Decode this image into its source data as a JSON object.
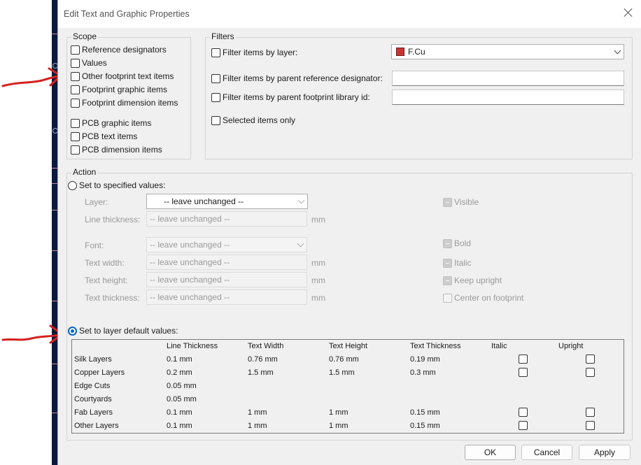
{
  "dialog": {
    "title": "Edit Text and Graphic Properties"
  },
  "scope": {
    "legend": "Scope",
    "items": [
      {
        "label": "Reference designators",
        "checked": false
      },
      {
        "label": "Values",
        "checked": false
      },
      {
        "label": "Other footprint text items",
        "checked": false
      },
      {
        "label": "Footprint graphic items",
        "checked": false
      },
      {
        "label": "Footprint dimension items",
        "checked": false
      },
      {
        "label": "PCB graphic items",
        "checked": false
      },
      {
        "label": "PCB text items",
        "checked": false
      },
      {
        "label": "PCB dimension items",
        "checked": false
      }
    ]
  },
  "filters": {
    "legend": "Filters",
    "by_layer": {
      "label": "Filter items by layer:",
      "value": "F.Cu",
      "color": "#c83434"
    },
    "by_ref": {
      "label": "Filter items by parent reference designator:",
      "value": ""
    },
    "by_lib": {
      "label": "Filter items by parent footprint library id:",
      "value": ""
    },
    "selected_only": {
      "label": "Selected items only"
    }
  },
  "action": {
    "legend": "Action",
    "set_specified": {
      "label": "Set to specified values:",
      "fields": {
        "layer": {
          "label": "Layer:",
          "value": "-- leave unchanged --"
        },
        "line_thickness": {
          "label": "Line thickness:",
          "value": "-- leave unchanged --",
          "unit": "mm"
        },
        "font": {
          "label": "Font:",
          "value": "-- leave unchanged --"
        },
        "text_width": {
          "label": "Text width:",
          "value": "-- leave unchanged --",
          "unit": "mm"
        },
        "text_height": {
          "label": "Text height:",
          "value": "-- leave unchanged --",
          "unit": "mm"
        },
        "text_thickness": {
          "label": "Text thickness:",
          "value": "-- leave unchanged --",
          "unit": "mm"
        }
      },
      "options": {
        "visible": "Visible",
        "bold": "Bold",
        "italic": "Italic",
        "keep_upright": "Keep upright",
        "center_on_footprint": "Center on footprint"
      }
    },
    "set_default": {
      "label": "Set to layer default values:",
      "selected": true,
      "table": {
        "headers": [
          "Line Thickness",
          "Text Width",
          "Text Height",
          "Text Thickness",
          "Italic",
          "Upright"
        ],
        "rows": [
          {
            "name": "Silk Layers",
            "line": "0.1 mm",
            "width": "0.76 mm",
            "height": "0.76 mm",
            "thick": "0.19 mm"
          },
          {
            "name": "Copper Layers",
            "line": "0.2 mm",
            "width": "1.5 mm",
            "height": "1.5 mm",
            "thick": "0.3 mm"
          },
          {
            "name": "Edge Cuts",
            "line": "0.05 mm",
            "width": "",
            "height": "",
            "thick": ""
          },
          {
            "name": "Courtyards",
            "line": "0.05 mm",
            "width": "",
            "height": "",
            "thick": ""
          },
          {
            "name": "Fab Layers",
            "line": "0.1 mm",
            "width": "1 mm",
            "height": "1 mm",
            "thick": "0.15 mm"
          },
          {
            "name": "Other Layers",
            "line": "0.1 mm",
            "width": "1 mm",
            "height": "1 mm",
            "thick": "0.15 mm"
          }
        ]
      }
    }
  },
  "buttons": {
    "ok": "OK",
    "cancel": "Cancel",
    "apply": "Apply"
  },
  "annotations": {
    "arrow_color": "#d42020"
  }
}
